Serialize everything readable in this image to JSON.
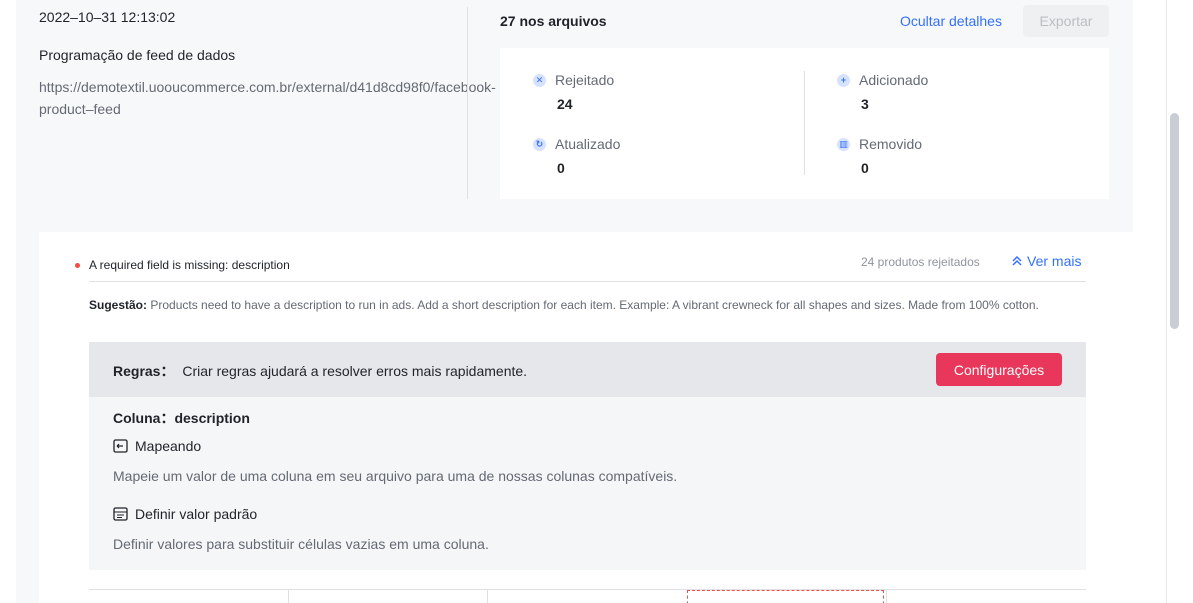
{
  "summary": {
    "timestamp": "2022–10–31 12:13:02",
    "schedule_title": "Programação de feed de dados",
    "feed_url_line1": "https://demotextil.uooucommerce.com.br/external/d41d8cd98f0/facebook-",
    "feed_url_line2": "product–feed"
  },
  "files": {
    "count_label": "27 nos arquivos",
    "hide_details": "Ocultar detalhes",
    "export": "Exportar"
  },
  "stats": {
    "rejected": {
      "label": "Rejeitado",
      "value": "24",
      "icon": "x-circle-icon"
    },
    "added": {
      "label": "Adicionado",
      "value": "3",
      "icon": "plus-circle-icon"
    },
    "updated": {
      "label": "Atualizado",
      "value": "0",
      "icon": "refresh-icon"
    },
    "removed": {
      "label": "Removido",
      "value": "0",
      "icon": "trash-icon"
    }
  },
  "issue": {
    "title": "A required field is missing: description",
    "rejected_count": "24 produtos rejeitados",
    "see_more": "Ver mais",
    "suggestion_label": "Sugestão:",
    "suggestion_text": "Products need to have a description to run in ads. Add a short description for each item. Example: A vibrant crewneck for all shapes and sizes. Made from 100% cotton."
  },
  "rules": {
    "label": "Regras：",
    "text": "Criar regras ajudará a resolver erros mais rapidamente.",
    "button": "Configurações",
    "column_label": "Coluna：",
    "column_name": "description",
    "mapping_title": "Mapeando",
    "mapping_desc": "Mapeie um valor de uma coluna em seu arquivo para uma de nossas colunas compatíveis.",
    "default_title": "Definir valor padrão",
    "default_desc": "Definir valores para substituir células vazias em uma coluna."
  },
  "colors": {
    "accent": "#3370ff",
    "primary_button": "#e8375a",
    "error_dot": "#f54a45"
  }
}
